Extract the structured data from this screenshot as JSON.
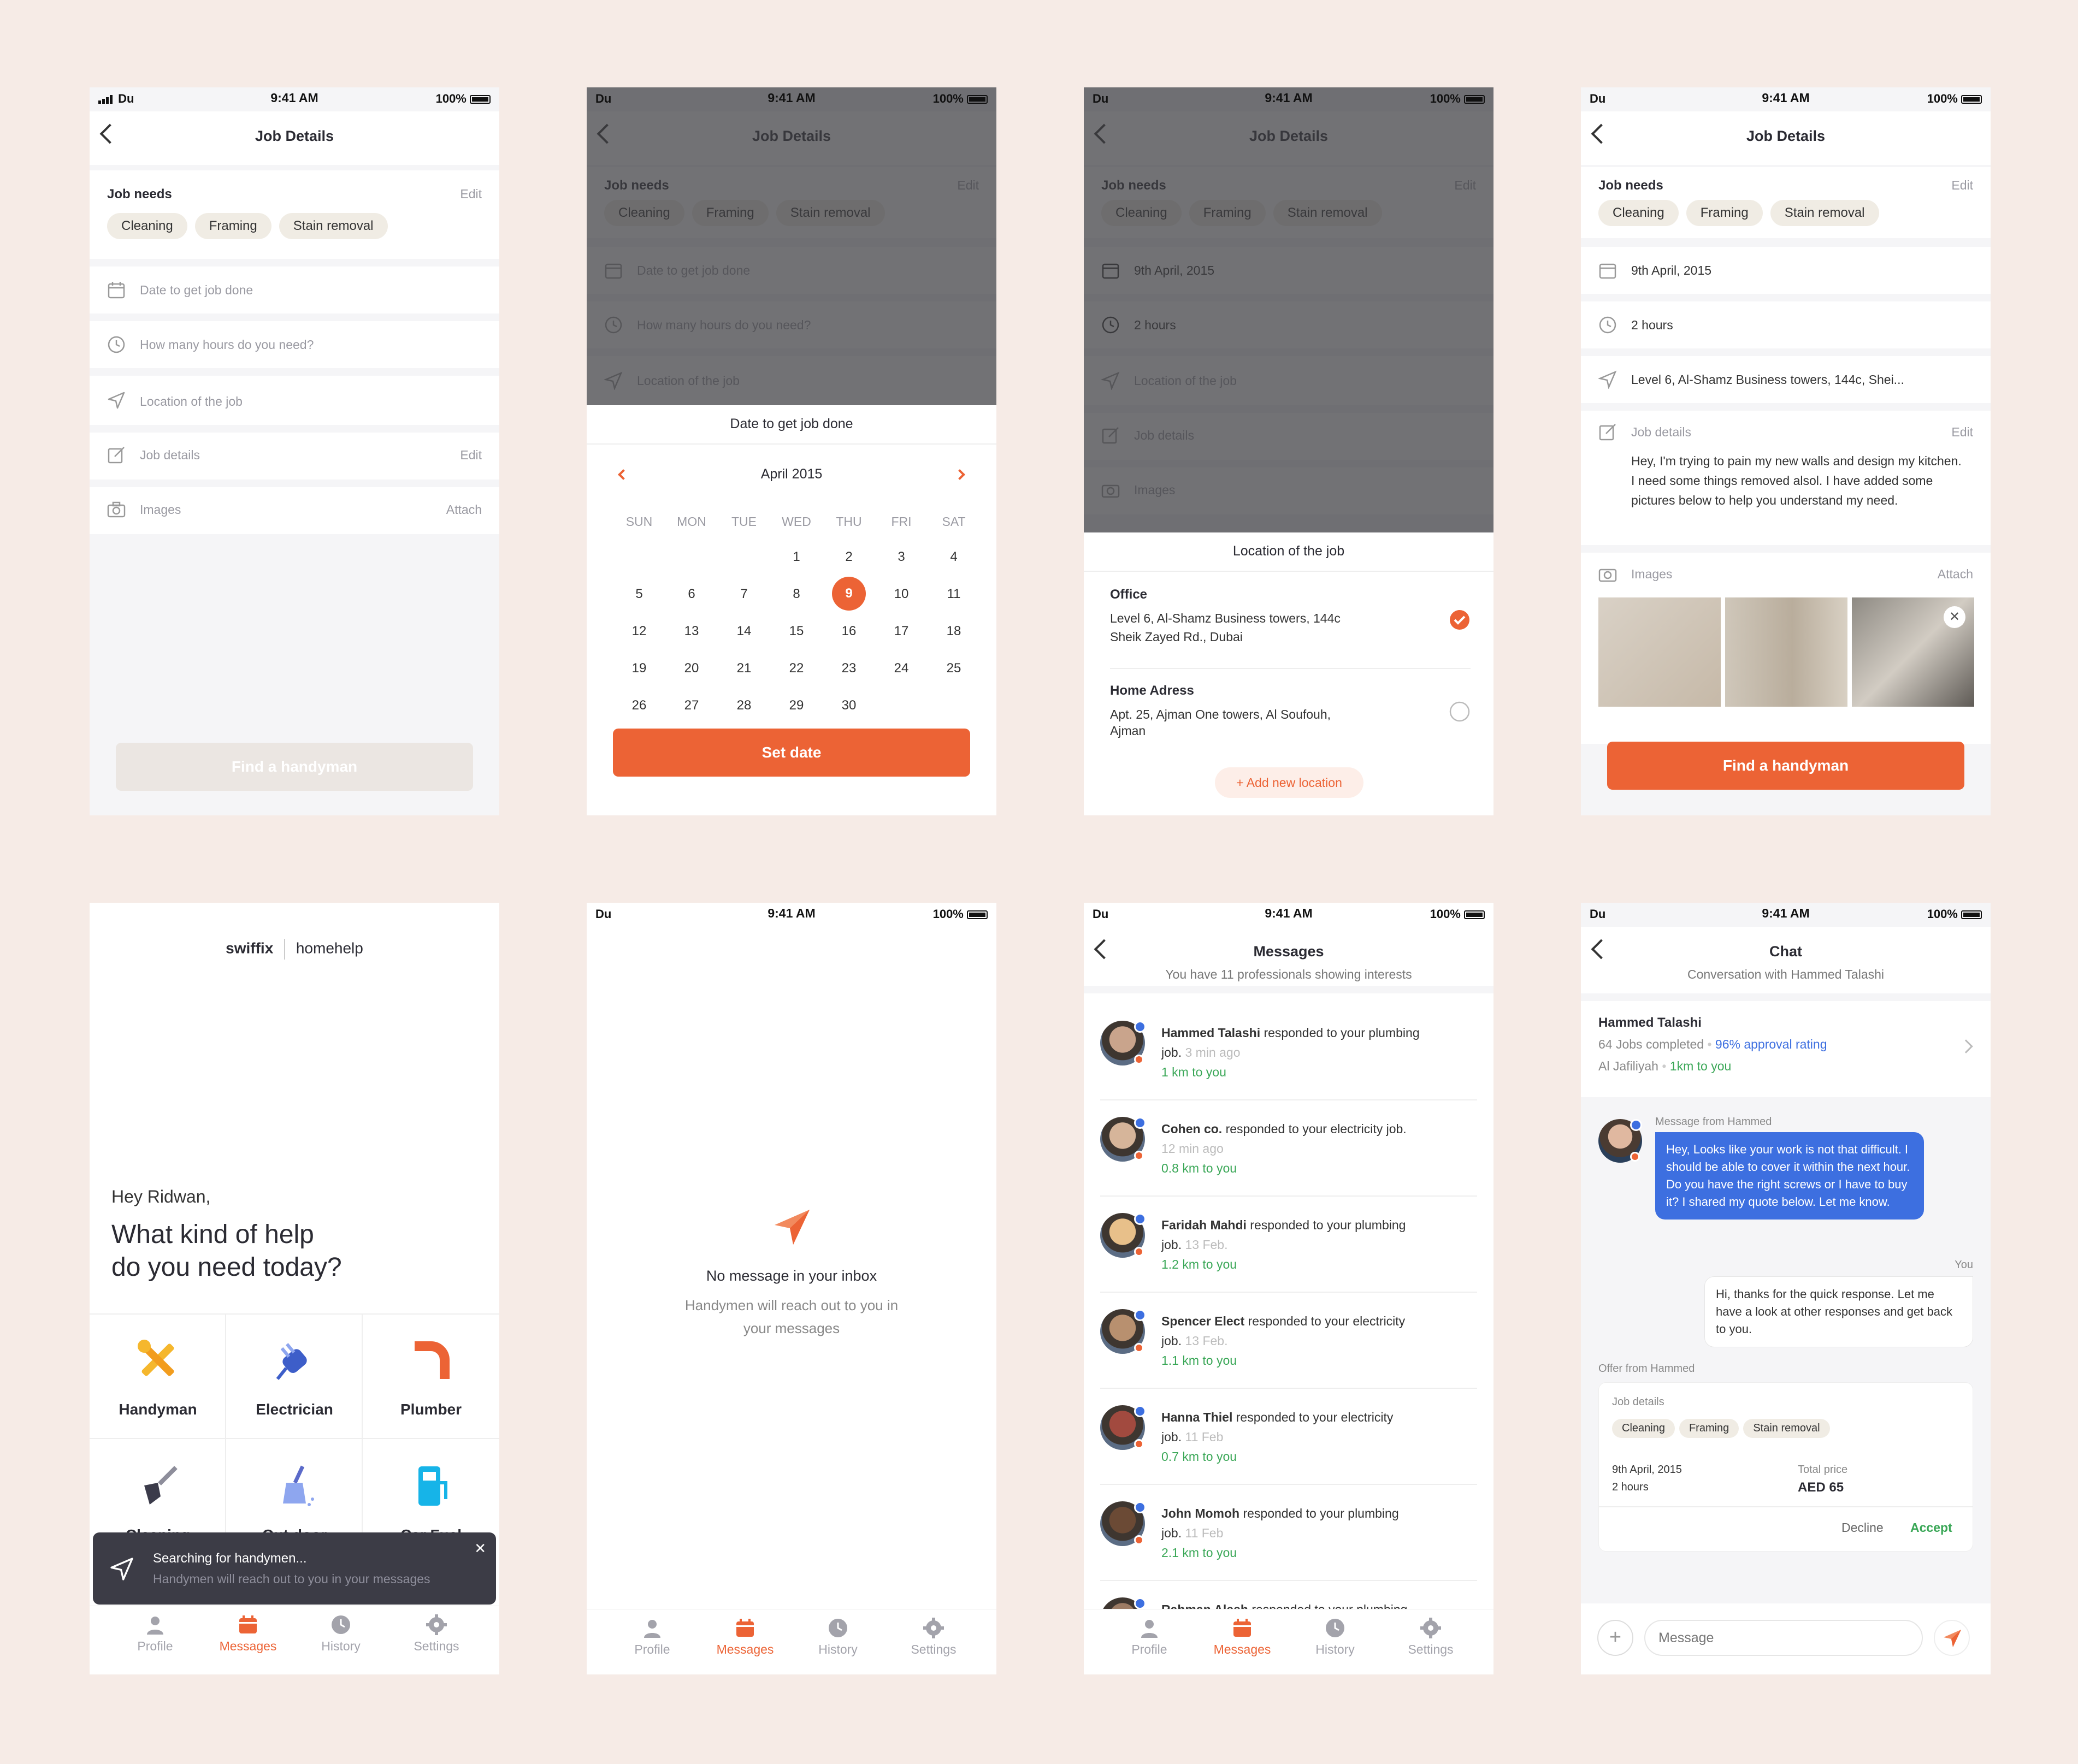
{
  "status": {
    "carrier": "Du",
    "time": "9:41 AM",
    "battery": "100%"
  },
  "job_details": {
    "title": "Job Details",
    "job_needs_label": "Job needs",
    "edit_label": "Edit",
    "chips": [
      "Cleaning",
      "Framing",
      "Stain removal"
    ],
    "date_placeholder": "Date to get job done",
    "hours_placeholder": "How many hours do you need?",
    "location_placeholder": "Location of the job",
    "details_placeholder": "Job details",
    "images_label": "Images",
    "attach_label": "Attach",
    "find_button": "Find a handyman"
  },
  "calendar": {
    "sheet_title": "Date to get job done",
    "month": "April 2015",
    "weekdays": [
      "SUN",
      "MON",
      "TUE",
      "WED",
      "THU",
      "FRI",
      "SAT"
    ],
    "weeks": [
      [
        "",
        "",
        "",
        "1",
        "2",
        "3",
        "4"
      ],
      [
        "5",
        "6",
        "7",
        "8",
        "9",
        "10",
        "11"
      ],
      [
        "12",
        "13",
        "14",
        "15",
        "16",
        "17",
        "18"
      ],
      [
        "19",
        "20",
        "21",
        "22",
        "23",
        "24",
        "25"
      ],
      [
        "26",
        "27",
        "28",
        "29",
        "30",
        "",
        ""
      ]
    ],
    "selected": "9",
    "set_button": "Set date"
  },
  "location_sheet": {
    "date_value": "9th April, 2015",
    "hours_value": "2 hours",
    "sheet_title": "Location of the job",
    "office_name": "Office",
    "office_line1": "Level 6, Al-Shamz Business towers, 144c",
    "office_line2": "Sheik Zayed Rd., Dubai",
    "home_name": "Home Adress",
    "home_line1": "Apt. 25, Ajman One towers, Al Soufouh,",
    "home_line2": "Ajman",
    "add_location": "Add new location"
  },
  "filled": {
    "location_value": "Level 6, Al-Shamz Business towers, 144c, Shei...",
    "details_text": "Hey, I'm trying to pain my new walls and design my kitchen. I need some things removed alsol. I have added some pictures below to help you understand my need."
  },
  "home": {
    "brand": "swiffix",
    "brand_sub": "homehelp",
    "greeting": "Hey Ridwan,",
    "question_line1": "What kind of help",
    "question_line2": "do you need today?",
    "services": [
      "Handyman",
      "Electrician",
      "Plumber",
      "Cleaning",
      "Out door",
      "Car Fuel"
    ],
    "toast_title": "Searching for handymen...",
    "toast_sub": "Handymen will reach out to you in your messages"
  },
  "tabs": [
    "Profile",
    "Messages",
    "History",
    "Settings"
  ],
  "empty_inbox": {
    "title": "No message in your inbox",
    "sub_line1": "Handymen will reach out to you in",
    "sub_line2": "your messages"
  },
  "messages": {
    "title": "Messages",
    "subtitle": "You have 11 professionals showing interests",
    "items": [
      {
        "name": "Hammed Talashi",
        "text": "responded to your plumbing",
        "text2": "job.",
        "time": "3 min ago",
        "dist": "1 km to you"
      },
      {
        "name": "Cohen co.",
        "text": "responded to your electricity job.",
        "text2": "",
        "time": "12 min ago",
        "dist": "0.8 km to you"
      },
      {
        "name": "Faridah Mahdi",
        "text": "responded to your plumbing",
        "text2": "job.",
        "time": "13 Feb.",
        "dist": "1.2 km to you"
      },
      {
        "name": "Spencer Elect",
        "text": "responded to your electricity",
        "text2": "job.",
        "time": "13 Feb.",
        "dist": "1.1 km to you"
      },
      {
        "name": "Hanna Thiel",
        "text": "responded to your electricity",
        "text2": "job.",
        "time": "11 Feb",
        "dist": "0.7 km to you"
      },
      {
        "name": "John Momoh",
        "text": "responded to your plumbing",
        "text2": "job.",
        "time": "11 Feb",
        "dist": "2.1 km to you"
      },
      {
        "name": "Rahman Alesh",
        "text": "responded to your plumbing",
        "text2": "",
        "time": "",
        "dist": ""
      }
    ]
  },
  "chat": {
    "title": "Chat",
    "subtitle": "Conversation with Hammed Talashi",
    "name": "Hammed Talashi",
    "jobs": "64 Jobs completed",
    "rating": "96% approval rating",
    "area": "Al Jafiliyah",
    "dist": "1km to you",
    "from_label": "Message from Hammed",
    "incoming": "Hey, Looks like your work is not that difficult. I should be able to cover it within the next hour. Do you have the right screws or I have to buy it? I shared my quote below. Let me know.",
    "you_label": "You",
    "outgoing": "Hi, thanks for the quick response. Let me have a look at other responses and get back to you.",
    "offer_label": "Offer from Hammed",
    "offer_job_label": "Job details",
    "offer_date": "9th April, 2015",
    "offer_hours": "2 hours",
    "total_label": "Total price",
    "total_value": "AED 65",
    "decline": "Decline",
    "accept": "Accept",
    "input_placeholder": "Message"
  },
  "colors": {
    "accent": "#EC6335",
    "bubble": "#3D6FE0",
    "green": "#3AA757"
  }
}
